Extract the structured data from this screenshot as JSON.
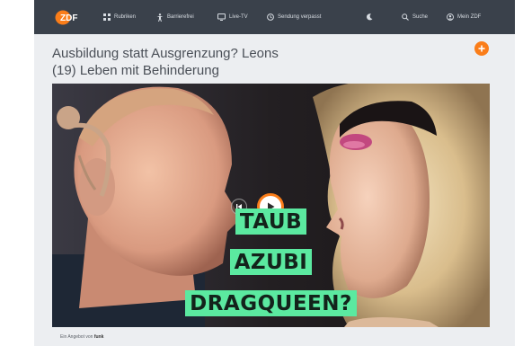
{
  "nav": {
    "logo_text": "ZDF",
    "items": [
      {
        "label": "Rubriken",
        "icon": "grid-icon"
      },
      {
        "label": "Barrierefrei",
        "icon": "accessibility-icon"
      },
      {
        "label": "Live-TV",
        "icon": "tv-icon"
      },
      {
        "label": "Sendung verpasst",
        "icon": "clock-icon"
      },
      {
        "label": "",
        "icon": "moon-icon"
      },
      {
        "label": "Suche",
        "icon": "search-icon"
      },
      {
        "label": "Mein ZDF",
        "icon": "user-icon"
      }
    ]
  },
  "article": {
    "title_line1": "Ausbildung statt Ausgrenzung? Leons",
    "title_line2": "(19) Leben mit Behinderung"
  },
  "video": {
    "caption": [
      "TAUB",
      "AZUBI",
      "DRAGQUEEN?"
    ]
  },
  "footer": {
    "prefix": "Ein Angebot von",
    "brand": "funk"
  },
  "colors": {
    "accent": "#fa7d19",
    "nav_bg": "#3a414b",
    "caption_bg": "#5be9a0",
    "page_bg": "#eceef1"
  }
}
